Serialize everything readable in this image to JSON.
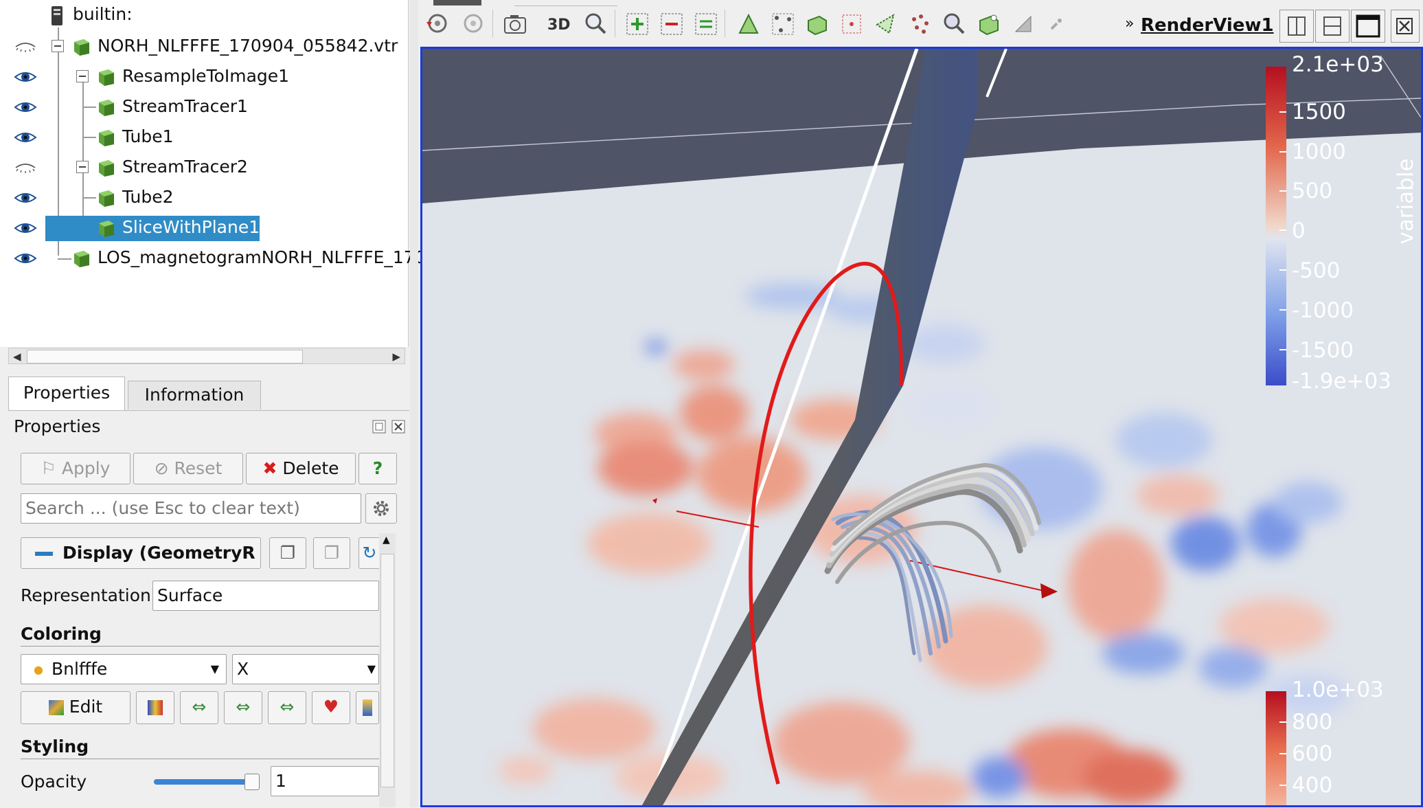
{
  "pipeline": {
    "root_label": "builtin:",
    "items": [
      {
        "label": "NORH_NLFFFE_170904_055842.vtr",
        "visible": false
      },
      {
        "label": "ResampleToImage1",
        "visible": true
      },
      {
        "label": "StreamTracer1",
        "visible": true
      },
      {
        "label": "Tube1",
        "visible": true
      },
      {
        "label": "StreamTracer2",
        "visible": false
      },
      {
        "label": "Tube2",
        "visible": true
      },
      {
        "label": "SliceWithPlane1",
        "visible": true,
        "selected": true
      },
      {
        "label": "LOS_magnetogramNORH_NLFFFE_170",
        "visible": true
      }
    ]
  },
  "tabs": {
    "properties": "Properties",
    "information": "Information"
  },
  "properties": {
    "header": "Properties",
    "apply": "Apply",
    "reset": "Reset",
    "delete": "Delete",
    "help": "?",
    "search_placeholder": "Search ... (use Esc to clear text)",
    "display_section": "Display (GeometryR",
    "representation_label": "Representation",
    "representation_value": "Surface",
    "coloring_label": "Coloring",
    "coloring_array": "Bnlfffe",
    "coloring_component": "X",
    "edit": "Edit",
    "styling_label": "Styling",
    "opacity_label": "Opacity",
    "opacity_value": "1",
    "opacity_fraction": 1.0
  },
  "render_view": {
    "mode_3d": "3D",
    "title": "RenderView1",
    "colorbar_top": {
      "title": "variable",
      "labels": [
        "2.1e+03",
        "1500",
        "1000",
        "500",
        "0",
        "-500",
        "-1000",
        "-1500",
        "-1.9e+03"
      ]
    },
    "colorbar_bottom": {
      "labels": [
        "1.0e+03",
        "800",
        "600",
        "400"
      ]
    }
  },
  "colors": {
    "selection": "#308cc6",
    "view_border": "#1a3ae0",
    "background_dark": "#4f5467",
    "slice_plane": "#5b5d61",
    "field_line": "#e11a1a"
  }
}
